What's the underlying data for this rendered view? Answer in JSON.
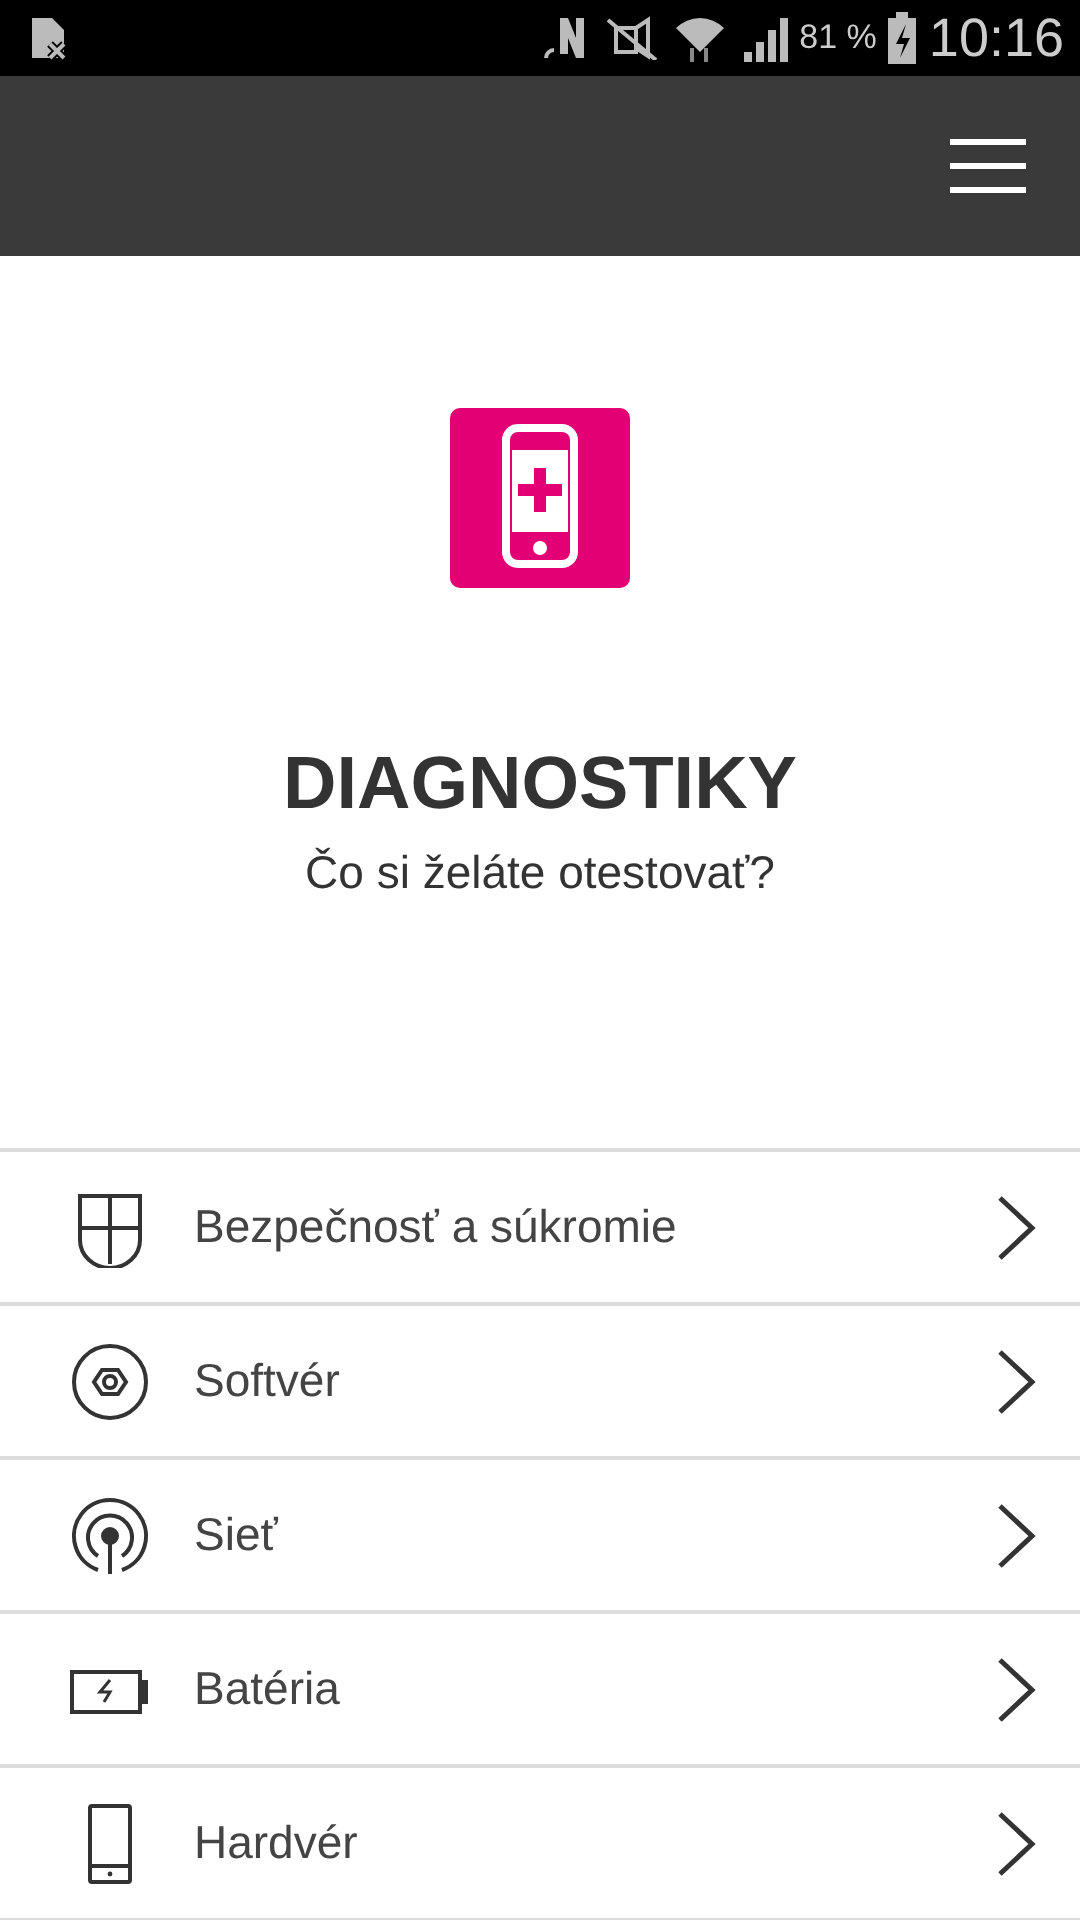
{
  "status_bar": {
    "battery": "81 %",
    "time": "10:16"
  },
  "title": "DIAGNOSTIKY",
  "subtitle": "Čo si želáte otestovať?",
  "items": [
    {
      "kind": "shield",
      "label": "Bezpečnosť a súkromie"
    },
    {
      "kind": "disc",
      "label": "Softvér"
    },
    {
      "kind": "signal",
      "label": "Sieť"
    },
    {
      "kind": "battery",
      "label": "Batéria"
    },
    {
      "kind": "phone",
      "label": "Hardvér"
    }
  ]
}
